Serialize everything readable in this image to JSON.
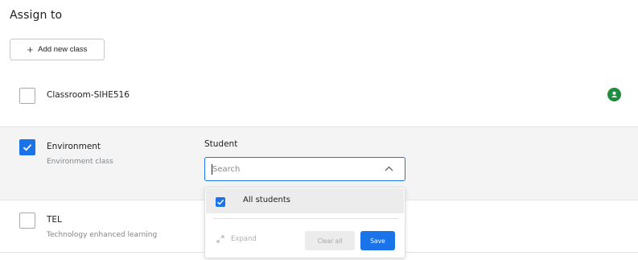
{
  "header": {
    "title": "Assign to",
    "add_class_label": "Add new class"
  },
  "classes": [
    {
      "name": "Classroom-SIHE516",
      "subtitle": "",
      "checked": false,
      "icon": "google-classroom-icon"
    },
    {
      "name": "Environment",
      "subtitle": "Environment class",
      "checked": true
    },
    {
      "name": "TEL",
      "subtitle": "Technology enhanced learning",
      "checked": false
    }
  ],
  "student_picker": {
    "label": "Student",
    "search_placeholder": "Search",
    "search_value": "",
    "options": [
      {
        "label": "All students",
        "checked": true
      }
    ],
    "expand_label": "Expand",
    "clear_label": "Clear all",
    "save_label": "Save"
  },
  "colors": {
    "accent": "#1a73e8",
    "classroom_green": "#1e8e3e",
    "selected_row_bg": "#f4f4f4"
  }
}
